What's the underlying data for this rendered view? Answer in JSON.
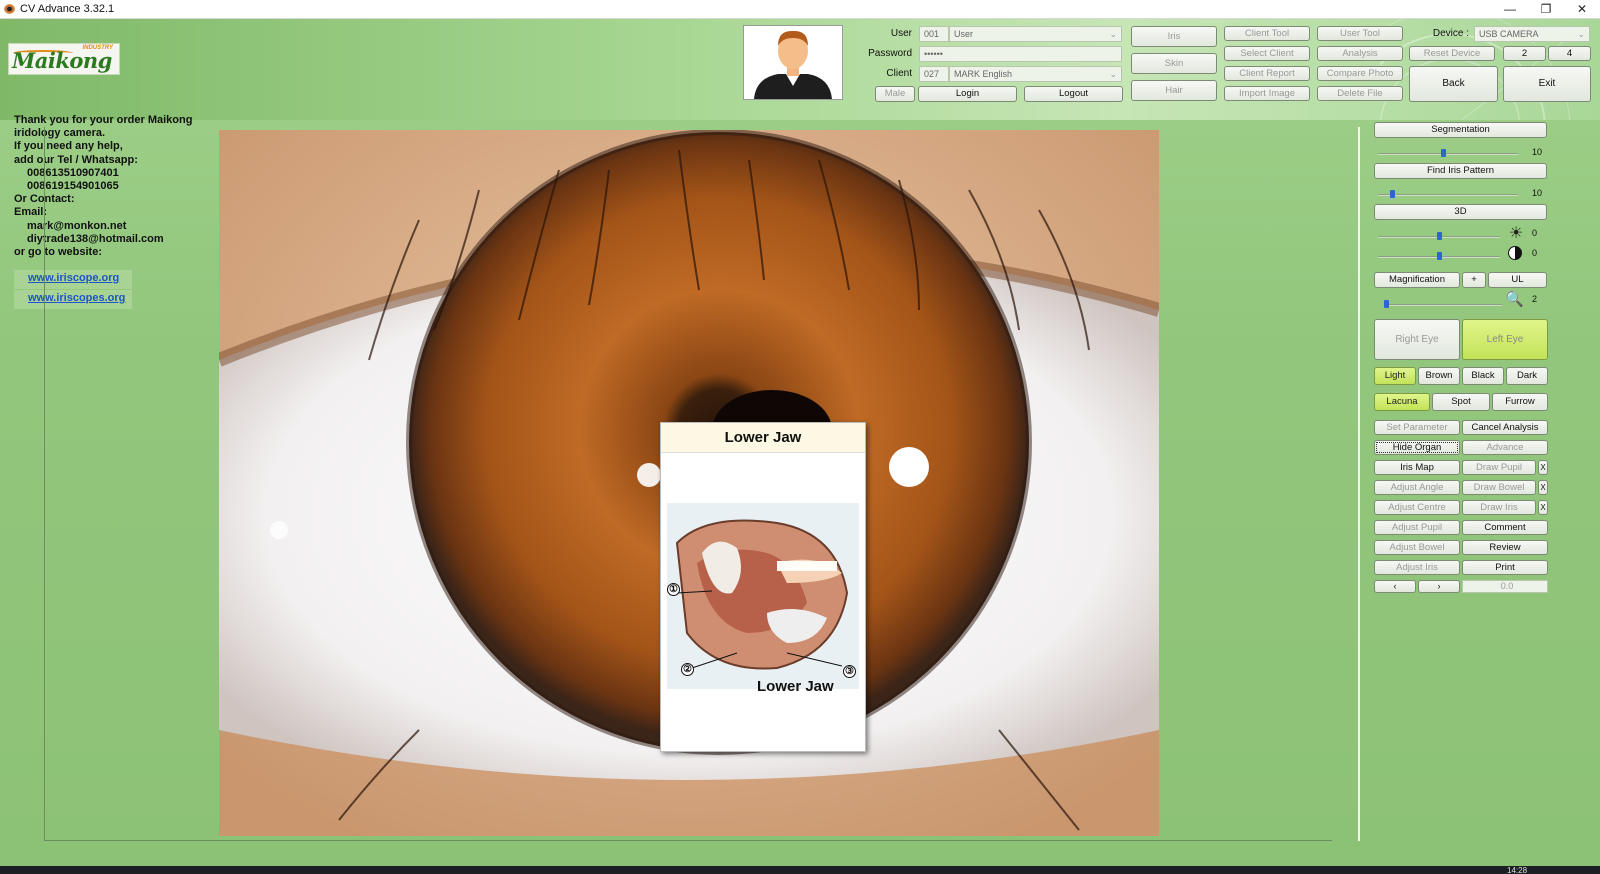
{
  "window": {
    "title": "CV Advance 3.32.1",
    "min_glyph": "—",
    "max_glyph": "❐",
    "close_glyph": "✕"
  },
  "brand": {
    "name": "Maikong",
    "tag": "INDUSTRY"
  },
  "login": {
    "user_label": "User",
    "user_id": "001",
    "user_name": "User",
    "password_label": "Password",
    "password_value": "••••••",
    "client_label": "Client",
    "client_id": "027",
    "client_name": "MARK English",
    "gender_button": "Male",
    "login_button": "Login",
    "logout_button": "Logout"
  },
  "modes": {
    "iris": "Iris",
    "skin": "Skin",
    "hair": "Hair"
  },
  "tools": {
    "client_tool": "Client Tool",
    "select_client": "Select Client",
    "client_report": "Client Report",
    "import_image": "Import Image",
    "user_tool": "User Tool",
    "analysis": "Analysis",
    "compare_photo": "Compare Photo",
    "delete_file": "Delete File"
  },
  "device": {
    "label": "Device :",
    "value": "USB CAMERA",
    "reset": "Reset Device",
    "opt2": "2",
    "opt4": "4",
    "back": "Back",
    "exit": "Exit"
  },
  "info": {
    "lines": [
      "Thank you for your order Maikong",
      "iridology camera.",
      "If you need any help,",
      "add our  Tel / Whatsapp:",
      "008613510907401",
      "008619154901065",
      "Or Contact:",
      "Email:",
      "mark@monkon.net",
      "diytrade138@hotmail.com",
      "or go to website:"
    ],
    "link1": "www.iriscope.org",
    "link2": "www.iriscopes.org"
  },
  "popup": {
    "title": "Lower Jaw",
    "caption": "Lower Jaw",
    "n1": "①",
    "n2": "②",
    "n3": "③"
  },
  "panel": {
    "segmentation": "Segmentation",
    "seg_value": "10",
    "find_pattern": "Find Iris Pattern",
    "find_value": "10",
    "three_d": "3D",
    "brightness_value": "0",
    "contrast_value": "0",
    "magnification": "Magnification",
    "plus": "+",
    "ul": "UL",
    "mag_value": "2",
    "right_eye": "Right Eye",
    "left_eye": "Left Eye",
    "light": "Light",
    "brown": "Brown",
    "black": "Black",
    "dark": "Dark",
    "lacuna": "Lacuna",
    "spot": "Spot",
    "furrow": "Furrow",
    "set_parameter": "Set Parameter",
    "cancel_analysis": "Cancel Analysis",
    "hide_organ": "Hide Organ",
    "advance": "Advance",
    "iris_map": "Iris Map",
    "draw_pupil": "Draw Pupil",
    "adjust_angle": "Adjust Angle",
    "draw_bowel": "Draw Bowel",
    "adjust_centre": "Adjust Centre",
    "draw_iris": "Draw Iris",
    "adjust_pupil": "Adjust Pupil",
    "comment": "Comment",
    "adjust_bowel": "Adjust Bowel",
    "review": "Review",
    "adjust_iris": "Adjust Iris",
    "print": "Print",
    "x": "X",
    "nav_left": "‹",
    "nav_right": "›",
    "angle_value": "0.0"
  },
  "taskbar": {
    "time": "14:28"
  }
}
